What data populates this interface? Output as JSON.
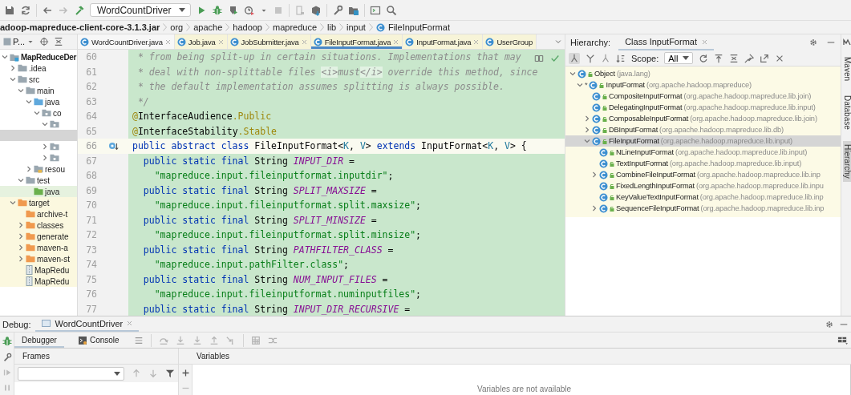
{
  "toolbar": {
    "run_config": "WordCountDriver"
  },
  "breadcrumb": [
    "adoop-mapreduce-client-core-3.1.3.jar",
    "org",
    "apache",
    "hadoop",
    "mapreduce",
    "lib",
    "input",
    "FileInputFormat"
  ],
  "project_panel": {
    "title": "P...",
    "tree": [
      {
        "name": "MapReduceDer",
        "kind": "module",
        "expanded": true,
        "selected": false,
        "children": [
          {
            "name": ".idea",
            "kind": "folder",
            "expanded": false,
            "selected": false
          },
          {
            "name": "src",
            "kind": "folder",
            "expanded": true,
            "selected": false,
            "children": [
              {
                "name": "main",
                "kind": "folder",
                "expanded": true,
                "selected": false,
                "children": [
                  {
                    "name": "java",
                    "kind": "source",
                    "expanded": true,
                    "selected": false,
                    "children": [
                      {
                        "name": "co",
                        "kind": "package",
                        "expanded": true,
                        "selected": false,
                        "children": [
                          {
                            "kind": "package",
                            "expanded": true,
                            "selected": false,
                            "children": [
                              {
                                "selected": true
                              }
                            ]
                          },
                          {
                            "kind": "package",
                            "expanded": false,
                            "selected": false
                          },
                          {
                            "kind": "package",
                            "expanded": false,
                            "selected": false
                          }
                        ]
                      }
                    ]
                  },
                  {
                    "name": "resou",
                    "kind": "resources",
                    "expanded": false,
                    "selected": false
                  }
                ]
              },
              {
                "name": "test",
                "kind": "folder",
                "expanded": true,
                "selected": false,
                "children": [
                  {
                    "name": "java",
                    "kind": "test-source",
                    "selected": false
                  }
                ]
              }
            ]
          },
          {
            "name": "target",
            "kind": "excluded",
            "expanded": true,
            "selected": false,
            "children": [
              {
                "name": "archive-t",
                "kind": "excluded",
                "selected": false
              },
              {
                "name": "classes",
                "kind": "excluded",
                "expanded": false,
                "selected": false
              },
              {
                "name": "generate",
                "kind": "excluded",
                "expanded": false,
                "selected": false
              },
              {
                "name": "maven-a",
                "kind": "excluded",
                "expanded": false,
                "selected": false
              },
              {
                "name": "maven-st",
                "kind": "excluded",
                "expanded": false,
                "selected": false
              },
              {
                "name": "MapRedu",
                "kind": "jar",
                "selected": false
              },
              {
                "name": "MapRedu",
                "kind": "jar",
                "selected": false
              }
            ]
          }
        ]
      }
    ]
  },
  "editor": {
    "tabs": [
      {
        "label": "WordCountDriver.java",
        "kind": "project",
        "selected": false,
        "closable": true
      },
      {
        "label": "Job.java",
        "kind": "library",
        "selected": false,
        "closable": true
      },
      {
        "label": "JobSubmitter.java",
        "kind": "library",
        "selected": false,
        "closable": true
      },
      {
        "label": "FileInputFormat.java",
        "kind": "library",
        "selected": true,
        "closable": true
      },
      {
        "label": "InputFormat.java",
        "kind": "library",
        "selected": false,
        "closable": true
      },
      {
        "label": "UserGroup",
        "kind": "library",
        "selected": false,
        "closable": false
      }
    ],
    "lines": [
      {
        "number": "60",
        "current": false,
        "tokens": [
          {
            "kind": "comment",
            "text": " * from being split-up in certain situations. Implementations that may"
          }
        ]
      },
      {
        "number": "61",
        "current": false,
        "tokens": [
          {
            "kind": "comment",
            "text": " * deal with non-splittable files "
          },
          {
            "kind": "doctag",
            "text": "<i>"
          },
          {
            "kind": "comment",
            "text": "must"
          },
          {
            "kind": "doctag",
            "text": "</i>"
          },
          {
            "kind": "comment",
            "text": " override this method, since"
          }
        ]
      },
      {
        "number": "62",
        "current": false,
        "tokens": [
          {
            "kind": "comment",
            "text": " * the default implementation assumes splitting is always possible."
          }
        ]
      },
      {
        "number": "63",
        "current": false,
        "tokens": [
          {
            "kind": "comment",
            "text": " */"
          }
        ]
      },
      {
        "number": "64",
        "current": false,
        "tokens": [
          {
            "kind": "annotation",
            "text": "@"
          },
          {
            "kind": "plain",
            "text": "InterfaceAudience"
          },
          {
            "kind": "annotation",
            "text": ".Public"
          }
        ]
      },
      {
        "number": "65",
        "current": false,
        "tokens": [
          {
            "kind": "annotation",
            "text": "@"
          },
          {
            "kind": "plain",
            "text": "InterfaceStability"
          },
          {
            "kind": "annotation",
            "text": ".Stable"
          }
        ]
      },
      {
        "number": "66",
        "current": true,
        "gutter_mark": true,
        "tokens": [
          {
            "kind": "keyword",
            "text": "public abstract class "
          },
          {
            "kind": "plain",
            "text": "FileInputFormat<"
          },
          {
            "kind": "typeparam",
            "text": "K"
          },
          {
            "kind": "plain",
            "text": ", "
          },
          {
            "kind": "typeparam",
            "text": "V"
          },
          {
            "kind": "plain",
            "text": "> "
          },
          {
            "kind": "keyword",
            "text": "extends "
          },
          {
            "kind": "plain",
            "text": "InputFormat<"
          },
          {
            "kind": "typeparam",
            "text": "K"
          },
          {
            "kind": "plain",
            "text": ", "
          },
          {
            "kind": "typeparam",
            "text": "V"
          },
          {
            "kind": "plain",
            "text": "> {"
          }
        ]
      },
      {
        "number": "67",
        "current": false,
        "tokens": [
          {
            "kind": "keyword",
            "text": "  public static final "
          },
          {
            "kind": "plain",
            "text": "String "
          },
          {
            "kind": "constant",
            "text": "INPUT_DIR"
          },
          {
            "kind": "plain",
            "text": " ="
          }
        ]
      },
      {
        "number": "68",
        "current": false,
        "tokens": [
          {
            "kind": "string",
            "text": "    \"mapreduce.input.fileinputformat.inputdir\""
          },
          {
            "kind": "plain",
            "text": ";"
          }
        ]
      },
      {
        "number": "69",
        "current": false,
        "tokens": [
          {
            "kind": "keyword",
            "text": "  public static final "
          },
          {
            "kind": "plain",
            "text": "String "
          },
          {
            "kind": "constant",
            "text": "SPLIT_MAXSIZE"
          },
          {
            "kind": "plain",
            "text": " ="
          }
        ]
      },
      {
        "number": "70",
        "current": false,
        "tokens": [
          {
            "kind": "string",
            "text": "    \"mapreduce.input.fileinputformat.split.maxsize\""
          },
          {
            "kind": "plain",
            "text": ";"
          }
        ]
      },
      {
        "number": "71",
        "current": false,
        "tokens": [
          {
            "kind": "keyword",
            "text": "  public static final "
          },
          {
            "kind": "plain",
            "text": "String "
          },
          {
            "kind": "constant",
            "text": "SPLIT_MINSIZE"
          },
          {
            "kind": "plain",
            "text": " ="
          }
        ]
      },
      {
        "number": "72",
        "current": false,
        "tokens": [
          {
            "kind": "string",
            "text": "    \"mapreduce.input.fileinputformat.split.minsize\""
          },
          {
            "kind": "plain",
            "text": ";"
          }
        ]
      },
      {
        "number": "73",
        "current": false,
        "tokens": [
          {
            "kind": "keyword",
            "text": "  public static final "
          },
          {
            "kind": "plain",
            "text": "String "
          },
          {
            "kind": "constant",
            "text": "PATHFILTER_CLASS"
          },
          {
            "kind": "plain",
            "text": " ="
          }
        ]
      },
      {
        "number": "74",
        "current": false,
        "tokens": [
          {
            "kind": "string",
            "text": "    \"mapreduce.input.pathFilter.class\""
          },
          {
            "kind": "plain",
            "text": ";"
          }
        ]
      },
      {
        "number": "75",
        "current": false,
        "tokens": [
          {
            "kind": "keyword",
            "text": "  public static final "
          },
          {
            "kind": "plain",
            "text": "String "
          },
          {
            "kind": "constant",
            "text": "NUM_INPUT_FILES"
          },
          {
            "kind": "plain",
            "text": " ="
          }
        ]
      },
      {
        "number": "76",
        "current": false,
        "tokens": [
          {
            "kind": "string",
            "text": "    \"mapreduce.input.fileinputformat.numinputfiles\""
          },
          {
            "kind": "plain",
            "text": ";"
          }
        ]
      },
      {
        "number": "77",
        "current": false,
        "tokens": [
          {
            "kind": "keyword",
            "text": "  public static final "
          },
          {
            "kind": "plain",
            "text": "String "
          },
          {
            "kind": "constant",
            "text": "INPUT_DIR_RECURSIVE"
          },
          {
            "kind": "plain",
            "text": " ="
          }
        ]
      }
    ]
  },
  "hierarchy": {
    "title": "Hierarchy:",
    "tab": "Class InputFormat",
    "scope_label": "Scope:",
    "scope": "All",
    "tree": [
      {
        "name": "Object",
        "package": "(java.lang)",
        "expanded": true,
        "selected": false,
        "children": [
          {
            "name": "InputFormat",
            "marker": "*",
            "package": "(org.apache.hadoop.mapreduce)",
            "expanded": true,
            "selected": false,
            "children": [
              {
                "name": "CompositeInputFormat",
                "package": "(org.apache.hadoop.mapreduce.lib.join)",
                "selected": false
              },
              {
                "name": "DelegatingInputFormat",
                "package": "(org.apache.hadoop.mapreduce.lib.input)",
                "selected": false
              },
              {
                "name": "ComposableInputFormat",
                "package": "(org.apache.hadoop.mapreduce.lib.join)",
                "expanded": false,
                "selected": false
              },
              {
                "name": "DBInputFormat",
                "package": "(org.apache.hadoop.mapreduce.lib.db)",
                "expanded": false,
                "selected": false
              },
              {
                "name": "FileInputFormat",
                "package": "(org.apache.hadoop.mapreduce.lib.input)",
                "expanded": true,
                "selected": true,
                "children": [
                  {
                    "name": "NLineInputFormat",
                    "package": "(org.apache.hadoop.mapreduce.lib.input)",
                    "selected": false
                  },
                  {
                    "name": "TextInputFormat",
                    "package": "(org.apache.hadoop.mapreduce.lib.input)",
                    "selected": false
                  },
                  {
                    "name": "CombineFileInputFormat",
                    "package": "(org.apache.hadoop.mapreduce.lib.inp",
                    "expanded": false,
                    "selected": false
                  },
                  {
                    "name": "FixedLengthInputFormat",
                    "package": "(org.apache.hadoop.mapreduce.lib.inpu",
                    "selected": false
                  },
                  {
                    "name": "KeyValueTextInputFormat",
                    "package": "(org.apache.hadoop.mapreduce.lib.inp",
                    "selected": false
                  },
                  {
                    "name": "SequenceFileInputFormat",
                    "package": "(org.apache.hadoop.mapreduce.lib.inp",
                    "expanded": false,
                    "selected": false
                  }
                ]
              }
            ]
          }
        ]
      }
    ]
  },
  "right_stripe": [
    {
      "label": "Maven",
      "selected": false
    },
    {
      "label": "Database",
      "selected": false
    },
    {
      "label": "Hierarchy",
      "selected": true
    }
  ],
  "debug": {
    "title": "Debug:",
    "session": "WordCountDriver",
    "tabs": [
      {
        "label": "Debugger",
        "kind": "debugger",
        "selected": true
      },
      {
        "label": "Console",
        "kind": "console",
        "selected": false
      }
    ],
    "frames_label": "Frames",
    "variables_label": "Variables",
    "empty_message": "Variables are not available"
  }
}
